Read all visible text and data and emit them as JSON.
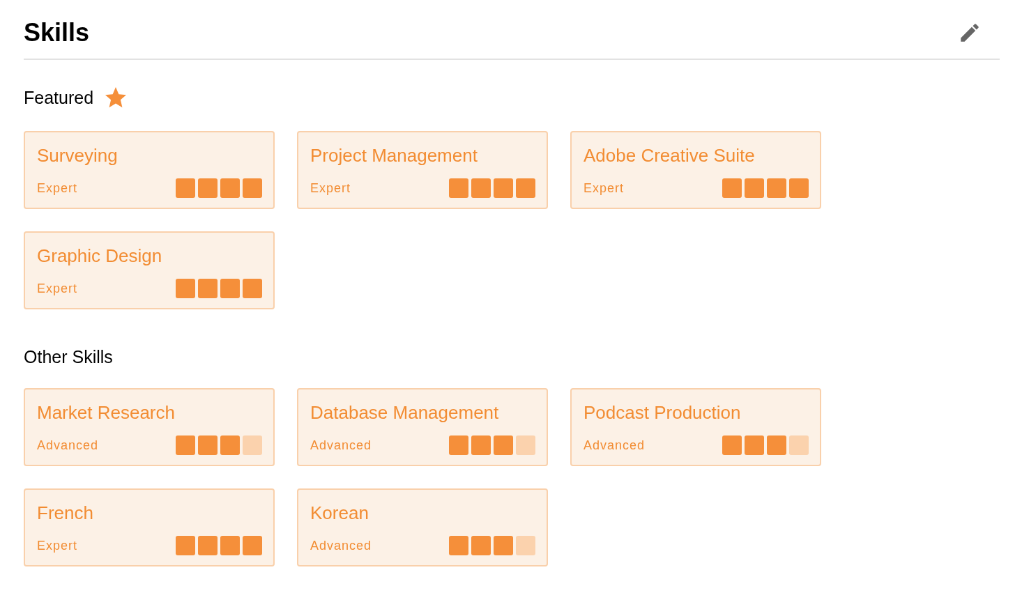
{
  "title": "Skills",
  "sections": [
    {
      "heading": "Featured",
      "starred": true,
      "skills": [
        {
          "name": "Surveying",
          "level_label": "Expert",
          "stars": 4
        },
        {
          "name": "Project Management",
          "level_label": "Expert",
          "stars": 4
        },
        {
          "name": "Adobe Creative Suite",
          "level_label": "Expert",
          "stars": 4
        },
        {
          "name": "Graphic Design",
          "level_label": "Expert",
          "stars": 4
        }
      ]
    },
    {
      "heading": "Other Skills",
      "starred": false,
      "skills": [
        {
          "name": "Market Research",
          "level_label": "Advanced",
          "stars": 3
        },
        {
          "name": "Database Management",
          "level_label": "Advanced",
          "stars": 3
        },
        {
          "name": "Podcast Production",
          "level_label": "Advanced",
          "stars": 3
        },
        {
          "name": "French",
          "level_label": "Expert",
          "stars": 4
        },
        {
          "name": "Korean",
          "level_label": "Advanced",
          "stars": 3
        }
      ]
    }
  ]
}
